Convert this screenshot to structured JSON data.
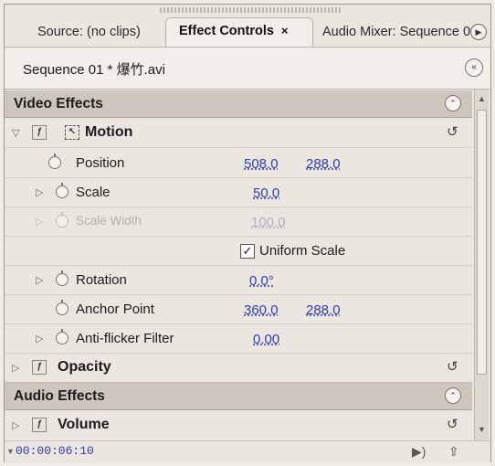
{
  "tabs": {
    "source": "Source: (no clips)",
    "effect_controls": "Effect Controls",
    "close_glyph": "×",
    "audio_mixer": "Audio Mixer: Sequence 0"
  },
  "sequence": {
    "label": "Sequence 01 * 爆竹.avi"
  },
  "video_effects": {
    "title": "Video Effects",
    "motion": {
      "name": "Motion",
      "position": {
        "label": "Position",
        "x": "508.0",
        "y": "288.0"
      },
      "scale": {
        "label": "Scale",
        "value": "50.0"
      },
      "scale_width": {
        "label": "Scale Width",
        "value": "100.0"
      },
      "uniform_scale": {
        "label": "Uniform Scale",
        "checked": true
      },
      "rotation": {
        "label": "Rotation",
        "value": "0.0°"
      },
      "anchor_point": {
        "label": "Anchor Point",
        "x": "360.0",
        "y": "288.0"
      },
      "anti_flicker": {
        "label": "Anti-flicker Filter",
        "value": "0.00"
      }
    },
    "opacity": {
      "name": "Opacity"
    }
  },
  "audio_effects": {
    "title": "Audio Effects",
    "volume": {
      "name": "Volume"
    }
  },
  "footer": {
    "timecode": "00:00:06:10"
  },
  "colors": {
    "value_blue": "#2e3fb0",
    "section_bg": "#cdc6bd",
    "panel_bg": "#ebe6e0"
  },
  "icons": [
    "stopwatch-icon",
    "reset-icon",
    "fx-toggle-icon",
    "motion-transform-icon",
    "collapse-up-icon",
    "panel-menu-icon",
    "play-audio-icon",
    "export-icon"
  ]
}
